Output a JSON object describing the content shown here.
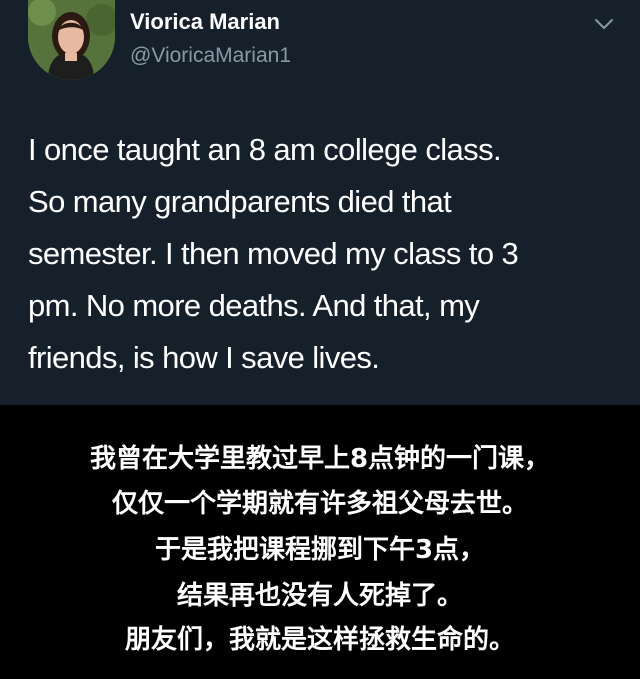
{
  "tweet": {
    "author_name": "Viorica Marian",
    "author_handle": "@VioricaMarian1",
    "text_lines": [
      "I once taught an 8 am college class.",
      "So many grandparents died that",
      "semester. I then moved my class to 3",
      "pm. No more deaths. And that, my",
      "friends, is how I save lives."
    ],
    "menu_icon": "chevron-down-icon",
    "avatar_icon": "user-avatar"
  },
  "caption": {
    "lines": [
      "我曾在大学里教过早上8点钟的一门课，",
      "仅仅一个学期就有许多祖父母去世。",
      "于是我把课程挪到下午3点，",
      "结果再也没有人死掉了。",
      "朋友们，我就是这样拯救生命的。"
    ]
  },
  "colors": {
    "card_background": "#15202b",
    "handle": "#8899a6",
    "caption_background": "#000000",
    "text": "#ffffff"
  }
}
